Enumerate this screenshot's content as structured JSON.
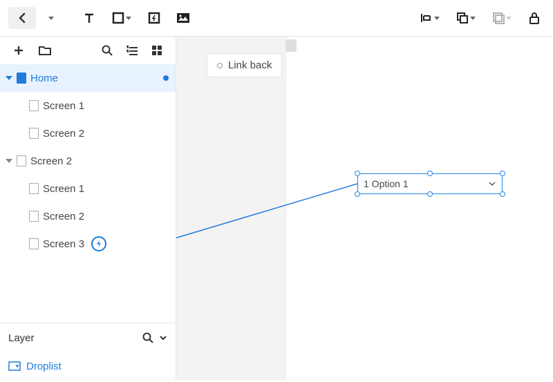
{
  "toolbar": {
    "back_icon": "chevron-left"
  },
  "sidebar": {
    "tree": [
      {
        "label": "Home",
        "selected": true,
        "level": 0,
        "icon": "page-filled",
        "caret": "down-blue",
        "dot": true
      },
      {
        "label": "Screen 1",
        "level": 2,
        "icon": "page"
      },
      {
        "label": "Screen 2",
        "level": 2,
        "icon": "page"
      },
      {
        "label": "Screen 2",
        "level": 0,
        "icon": "page",
        "caret": "down"
      },
      {
        "label": "Screen 1",
        "level": 2,
        "icon": "page"
      },
      {
        "label": "Screen 2",
        "level": 2,
        "icon": "page"
      },
      {
        "label": "Screen 3",
        "level": 2,
        "icon": "page",
        "event": true
      }
    ]
  },
  "layer": {
    "title": "Layer",
    "item": "Droplist"
  },
  "canvas": {
    "link_back": "Link back",
    "droplist_value": "1 Option 1"
  }
}
